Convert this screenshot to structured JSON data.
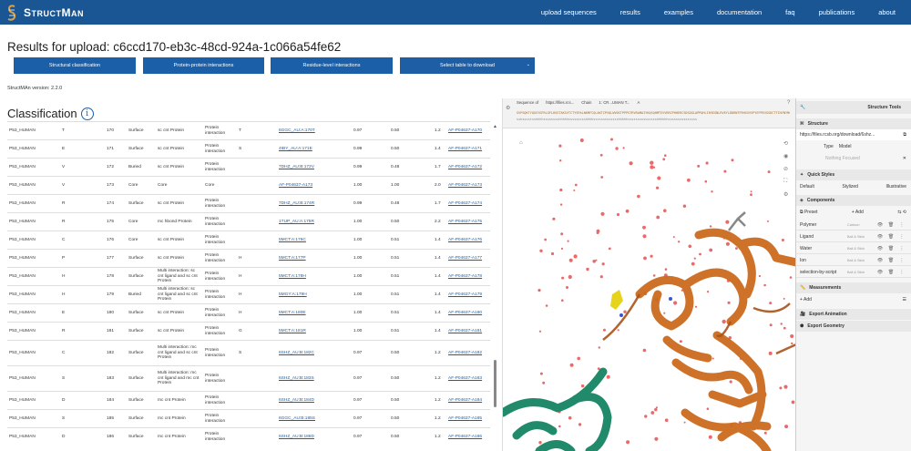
{
  "nav": {
    "brand_first": "S",
    "brand_rest": "TRUCT",
    "brand_m": "M",
    "brand_an": "AN",
    "links": [
      "upload sequences",
      "results",
      "examples",
      "documentation",
      "faq",
      "publications",
      "about"
    ]
  },
  "page_title": "Results for upload: c6ccd170-eb3c-48cd-924a-1c066a54fe62",
  "buttons": {
    "structural": "Structural classification",
    "ppi": "Protein-protein interactions",
    "residue": "Residue-level interactions",
    "download": "Select table to download"
  },
  "version": "StructMAn version: 2.2.0",
  "classification_title": "Classification",
  "info_icon": "i",
  "table_rows": [
    [
      "P53_HUMAN",
      "T",
      "170",
      "Surface",
      "sc cnt Protein",
      "Protein interaction",
      "T",
      "6GGC_AU:A:170T",
      "0.97",
      "0.50",
      "1.2",
      "AF-P04637-A170"
    ],
    [
      "P53_HUMAN",
      "E",
      "171",
      "Surface",
      "sc cnt Protein",
      "Protein interaction",
      "S",
      "4IBY_AU:A:171E",
      "0.99",
      "0.50",
      "1.4",
      "AF-P04637-A171"
    ],
    [
      "P53_HUMAN",
      "V",
      "172",
      "Buried",
      "sc cnt Protein",
      "Protein interaction",
      "",
      "7DHZ_AU:B:172V",
      "0.99",
      "0.48",
      "1.7",
      "AF-P04637-A172"
    ],
    [
      "P53_HUMAN",
      "V",
      "173",
      "Core",
      "Core",
      "Core",
      "",
      "AF-P04637-A173",
      "1.00",
      "1.00",
      "2.0",
      "AF-P04637-A173"
    ],
    [
      "P53_HUMAN",
      "R",
      "174",
      "Surface",
      "sc cnt Protein",
      "Protein interaction",
      "",
      "7DHZ_AU:B:174R",
      "0.99",
      "0.48",
      "1.7",
      "AF-P04637-A174"
    ],
    [
      "P53_HUMAN",
      "R",
      "175",
      "Core",
      "mc hbond Protein",
      "Protein interaction",
      "",
      "1TUP_AU:A:175R",
      "1.00",
      "0.50",
      "2.2",
      "AF-P04637-A175"
    ],
    [
      "P53_HUMAN",
      "C",
      "176",
      "Core",
      "sc cnt Protein",
      "Protein interaction",
      "",
      "5MCT:A:176C",
      "1.00",
      "0.51",
      "1.4",
      "AF-P04637-A176"
    ],
    [
      "P53_HUMAN",
      "P",
      "177",
      "Surface",
      "sc cnt Protein",
      "Protein interaction",
      "H",
      "5MCT:A:177P",
      "1.00",
      "0.51",
      "1.4",
      "AF-P04637-A177"
    ],
    [
      "P53_HUMAN",
      "H",
      "178",
      "Surface",
      "Multi interaction: sc cnt ligand and sc cnt Protein",
      "Protein interaction",
      "H",
      "5MCT:A:178H",
      "1.00",
      "0.51",
      "1.4",
      "AF-P04637-A178"
    ],
    [
      "P53_HUMAN",
      "H",
      "179",
      "Buried",
      "Multi interaction: sc cnt ligand and sc cnt Protein",
      "Protein interaction",
      "H",
      "5MGY:A:179H",
      "1.00",
      "0.51",
      "1.4",
      "AF-P04637-A179"
    ],
    [
      "P53_HUMAN",
      "E",
      "180",
      "Surface",
      "sc cnt Protein",
      "Protein interaction",
      "H",
      "5MCT:A:180E",
      "1.00",
      "0.51",
      "1.4",
      "AF-P04637-A180"
    ],
    [
      "P53_HUMAN",
      "R",
      "181",
      "Surface",
      "sc cnt Protein",
      "Protein interaction",
      "G",
      "5MCT:A:181R",
      "1.00",
      "0.51",
      "1.4",
      "AF-P04637-A181"
    ],
    [
      "P53_HUMAN",
      "C",
      "182",
      "Surface",
      "Multi interaction: mc cnt ligand and sc cnt Protein",
      "Protein interaction",
      "S",
      "6SHZ_AU:B:182C",
      "0.97",
      "0.50",
      "1.2",
      "AF-P04637-A182"
    ],
    [
      "P53_HUMAN",
      "S",
      "183",
      "Surface",
      "Multi interaction: mc cnt ligand and mc cnt Protein",
      "Protein interaction",
      "",
      "6SHZ_AU:B:183S",
      "0.97",
      "0.50",
      "1.2",
      "AF-P04637-A183"
    ],
    [
      "P53_HUMAN",
      "D",
      "184",
      "Surface",
      "mc cnt Protein",
      "Protein interaction",
      "",
      "6SHZ_AU:B:184D",
      "0.97",
      "0.50",
      "1.2",
      "AF-P04637-A184"
    ],
    [
      "P53_HUMAN",
      "S",
      "185",
      "Surface",
      "mc cnt Protein",
      "Protein interaction",
      "",
      "6GGC_AU:B:185S",
      "0.97",
      "0.50",
      "1.2",
      "AF-P04637-A185"
    ],
    [
      "P53_HUMAN",
      "D",
      "186",
      "Surface",
      "mc cnt Protein",
      "Protein interaction",
      "",
      "6SHZ_AU:B:186D",
      "0.97",
      "0.50",
      "1.2",
      "AF-P04637-A186"
    ]
  ],
  "viewer": {
    "seq_label": "Sequence of",
    "seq_source": "https://files.rcs...",
    "chain_label": "Chain",
    "chain_value": "1: CR...UMAN T...",
    "model_value": "A",
    "seq_line1": "SVPSQKTYQGSYGFRLGFLHSGTAKSVTCTYSPALNKMFCQLAKTCPVQLWVDSTPPPGTRVRAMAIYKQSQHMTEVVRRCPHHERCSDSDGLAPPQHLIRVEGNLRVEYLDDRNTFRHSVVVPYEPPEVGSDCTTIHYNYMCNSSCMGGMNRRPILTIITLEDSSGNLLGRNSFEVRVCACPGRDRRTEEENL",
    "seq_line2": "sshsssstsshhhhsssssssshhhhhssssssssshhhhssssssssssssshhhhhssssssssssssssshhhhhhsssssssssssssss"
  },
  "panel": {
    "title": "Structure Tools",
    "structure_label": "Structure",
    "structure_url": "https://files.rcsb.org/download/6shz...",
    "type_label": "Type",
    "type_value": "Model",
    "nothing_focused": "Nothing Focused",
    "quick_styles": "Quick Styles",
    "styles": [
      "Default",
      "Stylized",
      "Illustrative"
    ],
    "components": "Components",
    "preset": "Preset",
    "add": "+ Add",
    "component_rows": [
      {
        "name": "Polymer",
        "rep": "Cartoon"
      },
      {
        "name": "Ligand",
        "rep": "Ball & Stick"
      },
      {
        "name": "Water",
        "rep": "Ball & Stick"
      },
      {
        "name": "Ion",
        "rep": "Ball & Stick"
      },
      {
        "name": "selection-by-script",
        "rep": "Ball & Stick"
      }
    ],
    "measurements": "Measurements",
    "meas_add": "+ Add",
    "export_animation": "Export Animation",
    "export_geometry": "Export Geometry"
  },
  "colors": {
    "nav": "#1a5694",
    "button": "#1a5fa8",
    "chain_orange": "#cc6b1e",
    "chain_teal": "#218a6a",
    "water": "#e86a6a"
  }
}
